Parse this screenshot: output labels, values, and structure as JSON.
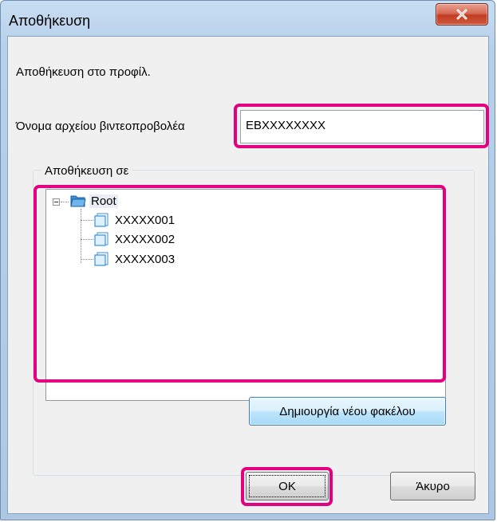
{
  "window": {
    "title": "Αποθήκευση",
    "close_glyph": "x"
  },
  "dialog": {
    "instruction": "Αποθήκευση στο προφίλ.",
    "filename_label": "Όνομα αρχείου βιντεοπροβολέα",
    "filename_value": "EBXXXXXXXX",
    "save_in_label": "Αποθήκευση σε",
    "tree": {
      "root": "Root",
      "children": [
        "XXXXX001",
        "XXXXX002",
        "XXXXX003"
      ]
    },
    "new_folder_button": "Δημιουργία νέου φακέλου",
    "ok_button": "OK",
    "cancel_button": "Άκυρο"
  },
  "colors": {
    "highlight": "#e4007f",
    "close_button": "#c94a33",
    "folder_blue": "#3a8fd9"
  },
  "icons": {
    "close": "close-icon",
    "folder": "folder-icon",
    "collapse": "collapse-icon"
  }
}
